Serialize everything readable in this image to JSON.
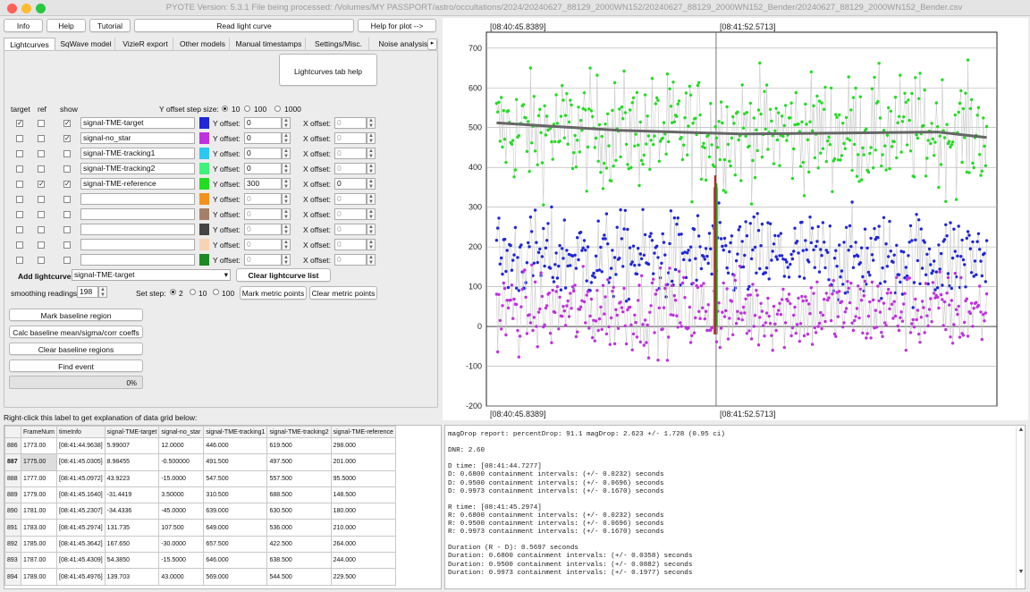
{
  "window": {
    "title": "PYOTE Version: 5.3.1  File being processed: /Volumes/MY PASSPORT/astro/occultations/2024/20240627_88129_2000WN152/20240627_88129_2000WN152_Bender/20240627_88129_2000WN152_Bender.csv"
  },
  "toolbar": {
    "info": "Info",
    "help": "Help",
    "tutorial": "Tutorial",
    "read": "Read light curve",
    "helpplot": "Help for plot -->"
  },
  "tabs": [
    "Lightcurves",
    "SqWave model",
    "VizieR export",
    "Other models",
    "Manual timestamps",
    "Settings/Misc.",
    "Noise analysis/"
  ],
  "tabs_more": "▸",
  "tabhelp": "Lightcurves tab help",
  "yoffset_step": {
    "label": "Y offset step size:",
    "options": [
      "10",
      "100",
      "1000"
    ]
  },
  "headers": {
    "target": "target",
    "ref": "ref",
    "show": "show"
  },
  "curves": [
    {
      "name": "signal-TME-target",
      "color": "#1f27d8",
      "y": "0",
      "x": "0",
      "target": true,
      "ref": false,
      "show": true,
      "enabled": false
    },
    {
      "name": "signal-no_star",
      "color": "#c130e0",
      "y": "0",
      "x": "0",
      "target": false,
      "ref": false,
      "show": true,
      "enabled": false
    },
    {
      "name": "signal-TME-tracking1",
      "color": "#2cc8f0",
      "y": "0",
      "x": "0",
      "target": false,
      "ref": false,
      "show": false,
      "enabled": false
    },
    {
      "name": "signal-TME-tracking2",
      "color": "#3ef27a",
      "y": "0",
      "x": "0",
      "target": false,
      "ref": false,
      "show": false,
      "enabled": false
    },
    {
      "name": "signal-TME-reference",
      "color": "#22dd22",
      "y": "300",
      "x": "0",
      "target": false,
      "ref": true,
      "show": true,
      "enabled": true
    },
    {
      "name": "",
      "color": "#f2921c",
      "y": "0",
      "x": "0",
      "target": false,
      "ref": false,
      "show": false,
      "enabled": false
    },
    {
      "name": "",
      "color": "#a58068",
      "y": "0",
      "x": "0",
      "target": false,
      "ref": false,
      "show": false,
      "enabled": false
    },
    {
      "name": "",
      "color": "#444444",
      "y": "0",
      "x": "0",
      "target": false,
      "ref": false,
      "show": false,
      "enabled": false
    },
    {
      "name": "",
      "color": "#f8d2b4",
      "y": "0",
      "x": "0",
      "target": false,
      "ref": false,
      "show": false,
      "enabled": false
    },
    {
      "name": "",
      "color": "#1c8a22",
      "y": "0",
      "x": "0",
      "target": false,
      "ref": false,
      "show": false,
      "enabled": false
    }
  ],
  "ylabel": "Y offset:",
  "xlabel": "X offset:",
  "add": {
    "label": "Add lightcurve",
    "value": "signal-TME-target",
    "clear": "Clear lightcurve list"
  },
  "smoothing": {
    "label": "smoothing readings",
    "value": "198"
  },
  "setstep": {
    "label": "Set step:",
    "options": [
      "2",
      "10",
      "100"
    ]
  },
  "metric": {
    "mark": "Mark metric points",
    "clear": "Clear metric points"
  },
  "actions": {
    "mark": "Mark baseline region",
    "calc": "Calc baseline mean/sigma/corr coeffs",
    "clear": "Clear baseline regions",
    "find": "Find event"
  },
  "progress": {
    "text": "0%",
    "value": 0
  },
  "grid_hint": "Right-click this label to get explanation of data grid below:",
  "grid": {
    "columns": [
      "",
      "FrameNum",
      "timeInfo",
      "signal-TME-target",
      "signal-no_star",
      "signal-TME-tracking1",
      "signal-TME-tracking2",
      "signal-TME-reference"
    ],
    "rows": [
      [
        "886",
        "1773.00",
        "[08:41:44.9638]",
        "5.99007",
        "12.0000",
        "446.000",
        "619.500",
        "298.000"
      ],
      [
        "887",
        "1775.00",
        "[08:41:45.0305]",
        "8.98455",
        "-0.500000",
        "491.500",
        "497.500",
        "201.000"
      ],
      [
        "888",
        "1777.00",
        "[08:41:45.0972]",
        "43.9223",
        "-15.0000",
        "547.500",
        "557.500",
        "95.5000"
      ],
      [
        "889",
        "1779.00",
        "[08:41:45.1640]",
        "-31.4419",
        "3.50000",
        "310.500",
        "688.500",
        "148.500"
      ],
      [
        "890",
        "1781.00",
        "[08:41:45.2307]",
        "-34.4336",
        "-45.0000",
        "639.000",
        "630.500",
        "180.000"
      ],
      [
        "891",
        "1783.00",
        "[08:41:45.2974]",
        "131.735",
        "107.500",
        "649.000",
        "536.000",
        "210.000"
      ],
      [
        "892",
        "1785.00",
        "[08:41:45.3642]",
        "167.650",
        "-30.0000",
        "657.500",
        "422.500",
        "264.000"
      ],
      [
        "893",
        "1787.00",
        "[08:41:45.4309]",
        "54.3850",
        "-15.5000",
        "646.000",
        "638.500",
        "244.000"
      ],
      [
        "894",
        "1789.00",
        "[08:41:45.4976]",
        "139.703",
        "43.0000",
        "569.000",
        "544.500",
        "229.500"
      ]
    ]
  },
  "report": [
    "magDrop report: percentDrop: 91.1 magDrop: 2.623 +/- 1.728 (0.95 ci)",
    "",
    "DNR: 2.60",
    "",
    "D time: [08:41:44.7277]",
    "D: 0.6800 containment intervals: (+/- 0.0232) seconds",
    "D: 0.9500 containment intervals: (+/- 0.0696) seconds",
    "D: 0.9973 containment intervals: (+/- 0.1670) seconds",
    "",
    "R time: [08:41:45.2974]",
    "R: 0.6800 containment intervals: (+/- 0.0232) seconds",
    "R: 0.9500 containment intervals: (+/- 0.0696) seconds",
    "R: 0.9973 containment intervals: (+/- 0.1670) seconds",
    "",
    "Duration (R - D): 0.5697 seconds",
    "Duration: 0.6800 containment intervals: (+/- 0.0358) seconds",
    "Duration: 0.9500 containment intervals: (+/- 0.0882) seconds",
    "Duration: 0.9973 containment intervals: (+/- 0.1977) seconds"
  ],
  "chart_data": {
    "type": "scatter",
    "top_time_labels": [
      "[08:40:45.8389]",
      "[08:41:52.5713]"
    ],
    "bottom_time_labels": [
      "[08:40:45.8389]",
      "[08:41:52.5713]"
    ],
    "yticks": [
      "700",
      "600",
      "500",
      "400",
      "300",
      "200",
      "100",
      "0",
      "-100",
      "-200"
    ],
    "ylim": [
      -200,
      740
    ],
    "xlim": [
      0,
      1
    ],
    "cursor_x": 0.45,
    "event_x": 0.448,
    "grid": true,
    "series": [
      {
        "color": "#22dd22",
        "mean": 490,
        "spread": 70,
        "count": 420,
        "trend": [
          [
            0,
            512
          ],
          [
            0.25,
            493
          ],
          [
            0.5,
            484
          ],
          [
            0.75,
            487
          ],
          [
            0.9,
            489
          ],
          [
            1,
            475
          ]
        ],
        "trendcolor": "#666666"
      },
      {
        "color": "#1f27d8",
        "mean": 175,
        "spread": 55,
        "count": 420
      },
      {
        "color": "#c130e0",
        "mean": 40,
        "spread": 50,
        "count": 420
      }
    ]
  }
}
